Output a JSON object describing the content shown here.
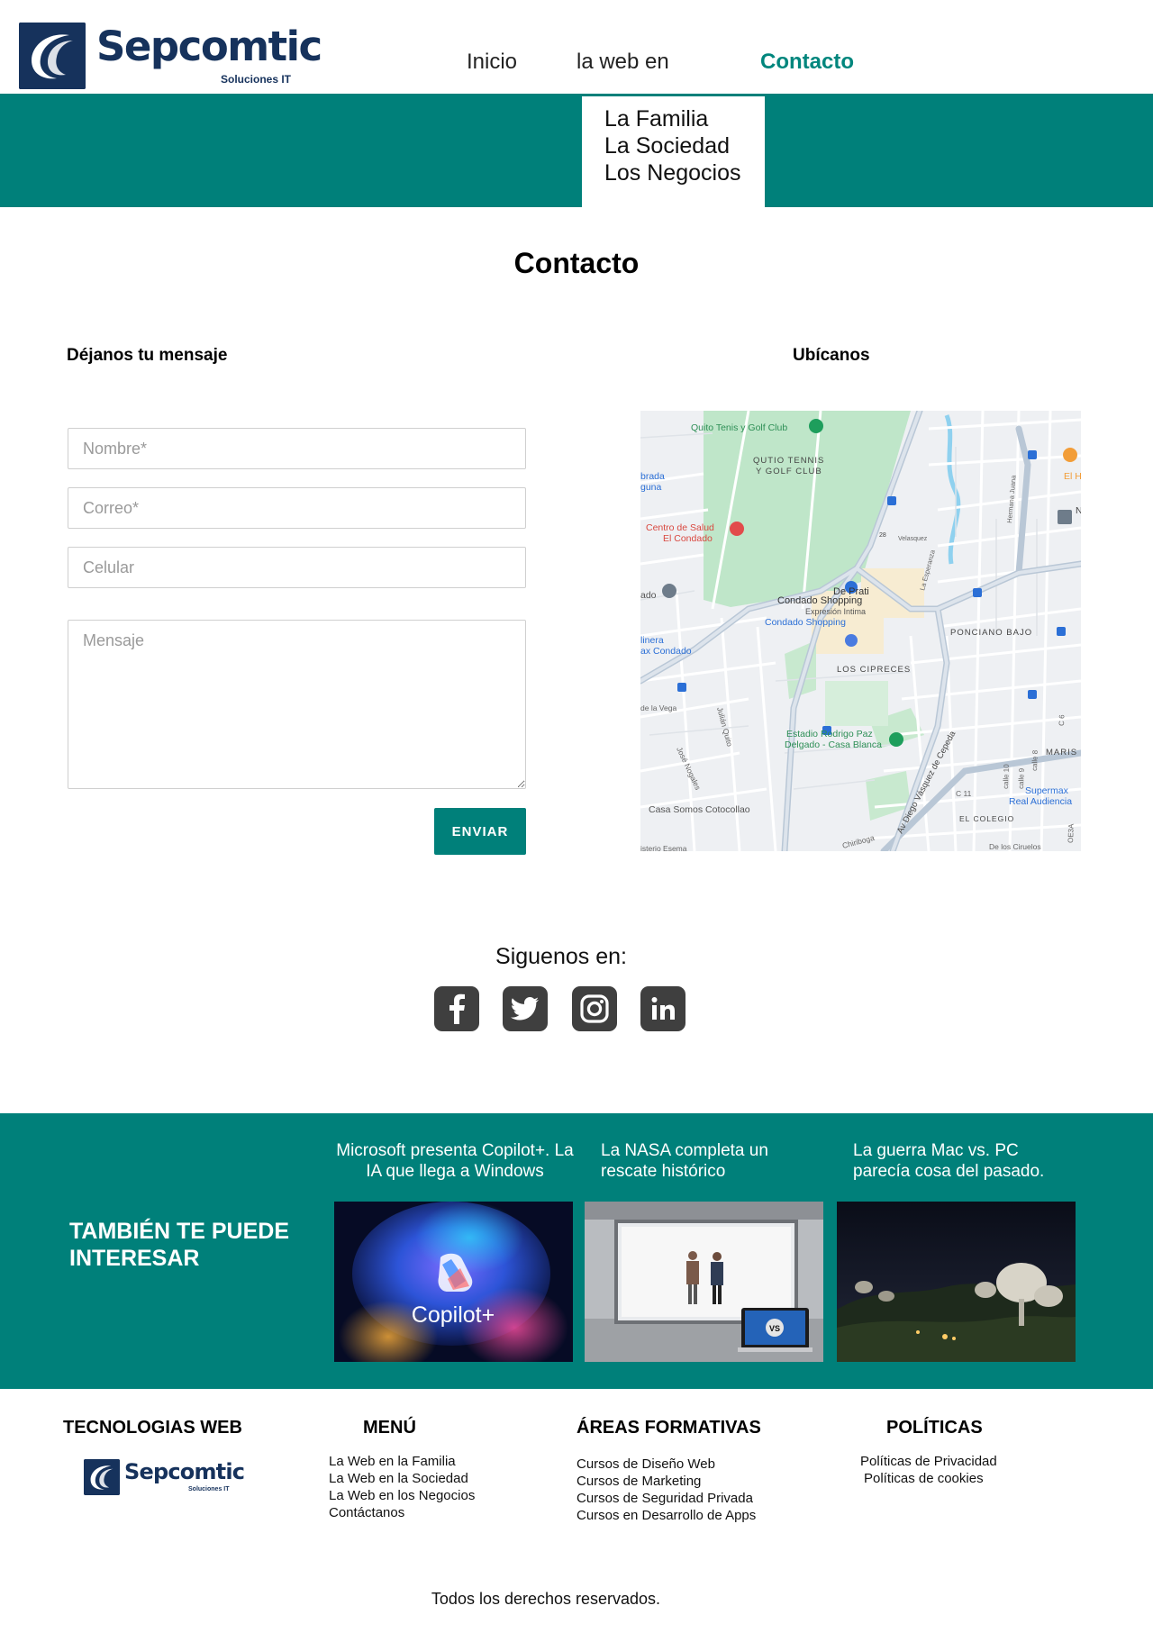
{
  "brand": {
    "name": "Sepcomtic",
    "tagline": "Soluciones IT",
    "color": "#16325c"
  },
  "nav": {
    "items": [
      {
        "label": "Inicio"
      },
      {
        "label": "la web en"
      },
      {
        "label": "Contacto",
        "active": true
      }
    ],
    "dropdown": [
      "La Familia",
      "La Sociedad",
      "Los Negocios"
    ]
  },
  "theme": {
    "accent": "#00807a",
    "active_nav": "#00867d"
  },
  "main": {
    "title": "Contacto",
    "form": {
      "heading": "Déjanos tu mensaje",
      "name_placeholder": "Nombre*",
      "email_placeholder": "Correo*",
      "phone_placeholder": "Celular",
      "message_placeholder": "Mensaje",
      "submit_label": "ENVIAR"
    },
    "map": {
      "heading": "Ubícanos",
      "labels": {
        "club": "Quito Tenis y Golf Club",
        "club_caps_1": "QUTIO TENNIS",
        "club_caps_2": "Y GOLF CLUB",
        "health_1": "Centro de Salud",
        "health_2": "El Condado",
        "prati": "De Prati",
        "condado": "Condado Shopping",
        "expresion": "Expresión Intima",
        "condado_blue": "Condado Shopping",
        "ponciano": "PONCIANO BAJO",
        "cipreces": "LOS CIPRECES",
        "estadio_1": "Estadio Rodrigo Paz",
        "estadio_2": "Delgado - Casa Blanca",
        "somos": "Casa Somos Cotocollao",
        "colegio": "EL COLEGIO",
        "supermax_1": "Supermax",
        "supermax_2": "Real Audiencia",
        "maris": "MARIS",
        "av_diego": "Av Diego Vásquez de Cepeda",
        "brada_1": "brada",
        "brada_2": "guna",
        "linera_1": "linera",
        "linera_2": "ax Condado",
        "ado": "ado",
        "de_la_vega": "de la Vega",
        "julian": "Julián Quito",
        "jose": "José Nogales",
        "velasquez": "Velasquez",
        "la_esperanza": "La Esperanza",
        "hermana_juana": "Hermana Juana",
        "chiriboga": "Chiriboga",
        "misterio": "isterio Esema",
        "de_los_ciruelos": "De los Ciruelos",
        "el_h": "El H",
        "n": "N",
        "route": "28",
        "calle_10": "calle 10",
        "calle_9": "calle 9",
        "calle_8": "calle 8",
        "c11": "C 11",
        "c6": "C 6",
        "oe3a": "OE3A"
      }
    }
  },
  "social": {
    "title": "Siguenos en:",
    "networks": [
      "facebook",
      "twitter",
      "instagram",
      "linkedin"
    ]
  },
  "interest": {
    "title": "TAMBIÉN TE PUEDE INTERESAR",
    "cards": [
      {
        "title": "Microsoft presenta Copilot+. La IA que llega a Windows",
        "image_text": "Copilot+"
      },
      {
        "title": "La NASA completa un rescate histórico",
        "image_text": "VS"
      },
      {
        "title": "La guerra Mac vs. PC parecía cosa del pasado."
      }
    ]
  },
  "footer": {
    "tech_title": "TECNOLOGIAS WEB",
    "menu_title": "MENÚ",
    "menu_items": [
      "La Web en la Familia",
      "La Web en la Sociedad",
      "La Web en los Negocios",
      "Contáctanos"
    ],
    "areas_title": "ÁREAS FORMATIVAS",
    "areas_items": [
      "Cursos de Diseño Web",
      "Cursos de Marketing",
      "Cursos de Seguridad Privada",
      "Cursos en Desarrollo de Apps"
    ],
    "policies_title": "POLÍTICAS",
    "policies_items": [
      "Políticas de Privacidad",
      "Políticas de cookies"
    ],
    "copyright": "Todos los derechos reservados."
  }
}
